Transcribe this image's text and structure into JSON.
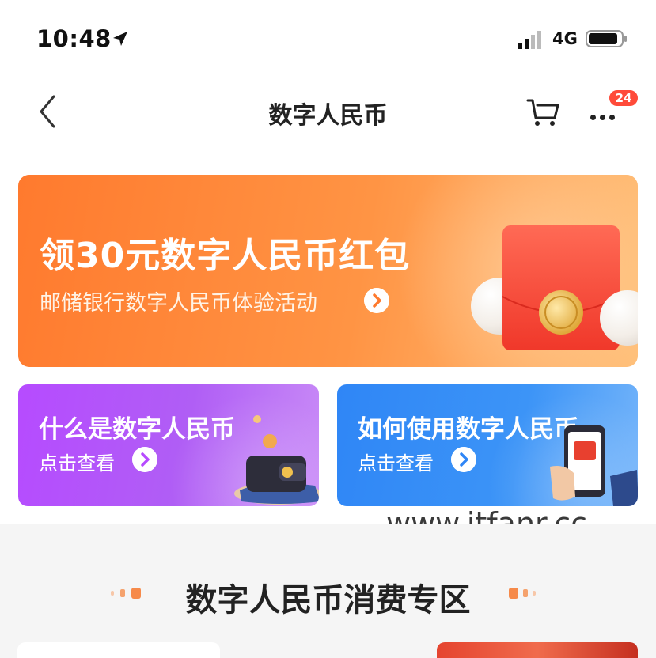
{
  "status_bar": {
    "time": "10:48",
    "network": "4G",
    "icons": [
      "location-arrow-icon",
      "signal-icon",
      "battery-icon"
    ]
  },
  "nav": {
    "title": "数字人民币",
    "badge_count": "24",
    "icons": [
      "back-icon",
      "cart-icon",
      "more-icon"
    ]
  },
  "main_banner": {
    "title": "领30元数字人民币红包",
    "subtitle": "邮储银行数字人民币体验活动"
  },
  "cards": [
    {
      "title": "什么是数字人民币",
      "link_label": "点击查看"
    },
    {
      "title": "如何使用数字人民币",
      "link_label": "点击查看"
    }
  ],
  "watermark": "www.itfanr.cc",
  "section": {
    "title": "数字人民币消费专区"
  },
  "colors": {
    "banner_orange": "#ff7a2e",
    "card_purple": "#b64bff",
    "card_blue": "#2f86f6",
    "badge_red": "#ff4b3a"
  }
}
